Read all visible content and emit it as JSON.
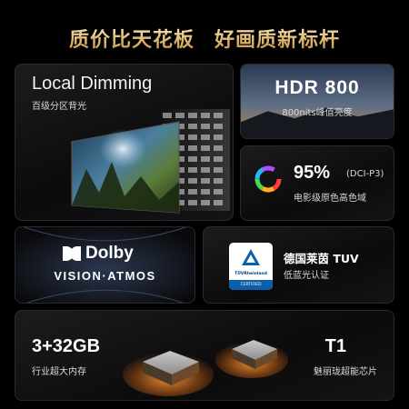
{
  "headline": {
    "left": "质价比天花板",
    "right": "好画质新标杆"
  },
  "local_dimming": {
    "title": "Local Dimming",
    "subtitle": "百级分区背光"
  },
  "hdr": {
    "title": "HDR 800",
    "subtitle": "800nits峰值亮度"
  },
  "color_gamut": {
    "percent": "95%",
    "standard": "(DCI-P3)",
    "subtitle": "电影级原色高色域"
  },
  "dolby": {
    "brand": "Dolby",
    "features": "VISION·ATMOS"
  },
  "tuv": {
    "badge_name": "TÜVRheinland",
    "badge_certified": "CERTIFIED",
    "title": "德国莱茵 TUV",
    "subtitle": "低蓝光认证"
  },
  "memory": {
    "title": "3+32GB",
    "subtitle": "行业超大内存"
  },
  "chip": {
    "title": "T1",
    "subtitle": "魅丽珑超能芯片"
  },
  "colors": {
    "gold_light": "#fff3d6",
    "gold_dark": "#b88a3e",
    "card_border": "#2a2a2e",
    "tuv_blue": "#0b5fa8"
  }
}
